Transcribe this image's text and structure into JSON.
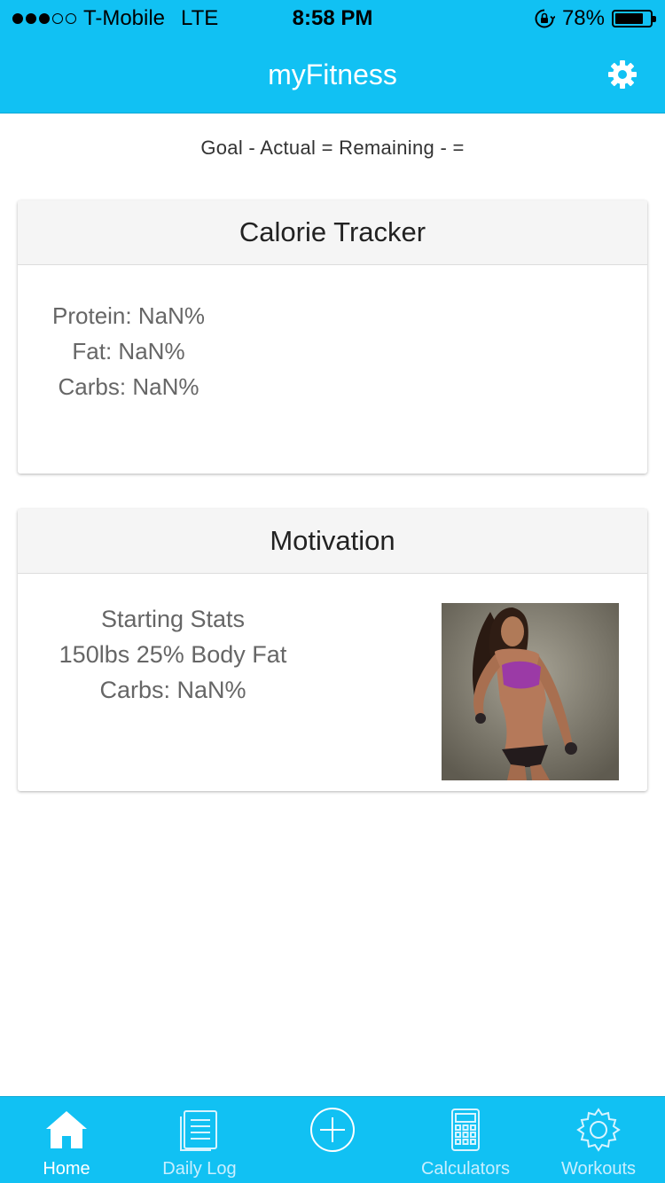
{
  "status_bar": {
    "carrier": "T-Mobile",
    "network": "LTE",
    "time": "8:58 PM",
    "battery": "78%",
    "signal_bars_filled": 3,
    "signal_bars_total": 5
  },
  "nav": {
    "title": "myFitness",
    "settings_icon": "gear-icon"
  },
  "summary_line": "Goal - Actual = Remaining - =",
  "calorie_tracker": {
    "title": "Calorie Tracker",
    "protein": "Protein: NaN%",
    "fat": "Fat: NaN%",
    "carbs": "Carbs: NaN%"
  },
  "motivation": {
    "title": "Motivation",
    "line1": "Starting Stats",
    "line2": "150lbs 25% Body Fat",
    "line3": "Carbs: NaN%"
  },
  "tabs": [
    {
      "label": "Home",
      "icon": "home-icon",
      "active": true
    },
    {
      "label": "Daily Log",
      "icon": "log-icon",
      "active": false
    },
    {
      "label": "",
      "icon": "add-circle-icon",
      "active": false
    },
    {
      "label": "Calculators",
      "icon": "calculator-icon",
      "active": false
    },
    {
      "label": "Workouts",
      "icon": "gear-outline-icon",
      "active": false
    }
  ],
  "colors": {
    "accent": "#11c1f3",
    "card_header_bg": "#f5f5f5",
    "text_muted": "#666666"
  }
}
